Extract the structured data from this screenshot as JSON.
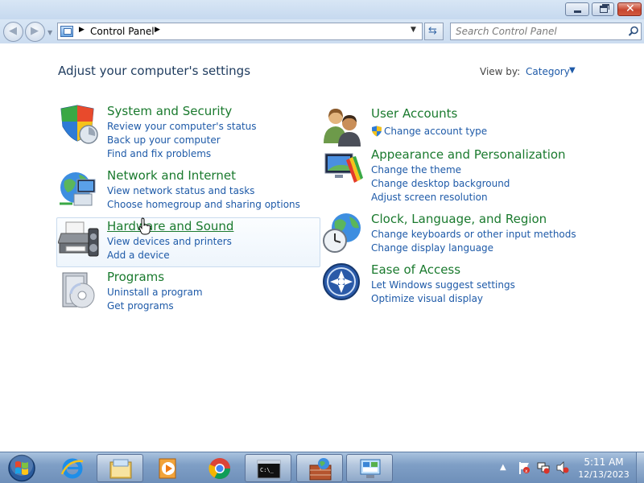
{
  "address": {
    "breadcrumb": "Control Panel",
    "search_placeholder": "Search Control Panel"
  },
  "page": {
    "heading": "Adjust your computer's settings",
    "view_by_label": "View by:",
    "view_by_value": "Category"
  },
  "categories": {
    "system_security": {
      "title": "System and Security",
      "links": [
        "Review your computer's status",
        "Back up your computer",
        "Find and fix problems"
      ]
    },
    "network_internet": {
      "title": "Network and Internet",
      "links": [
        "View network status and tasks",
        "Choose homegroup and sharing options"
      ]
    },
    "hardware_sound": {
      "title": "Hardware and Sound",
      "links": [
        "View devices and printers",
        "Add a device"
      ]
    },
    "programs": {
      "title": "Programs",
      "links": [
        "Uninstall a program",
        "Get programs"
      ]
    },
    "user_accounts": {
      "title": "User Accounts",
      "links": [
        "Change account type"
      ]
    },
    "appearance": {
      "title": "Appearance and Personalization",
      "links": [
        "Change the theme",
        "Change desktop background",
        "Adjust screen resolution"
      ]
    },
    "clock_region": {
      "title": "Clock, Language, and Region",
      "links": [
        "Change keyboards or other input methods",
        "Change display language"
      ]
    },
    "ease_access": {
      "title": "Ease of Access",
      "links": [
        "Let Windows suggest settings",
        "Optimize visual display"
      ]
    }
  },
  "taskbar": {
    "time": "5:11 AM",
    "date": "12/13/2023",
    "apps": [
      "internet-explorer-icon",
      "file-explorer-icon",
      "media-player-icon",
      "chrome-icon",
      "command-prompt-icon",
      "firewall-icon",
      "control-panel-icon"
    ]
  },
  "colors": {
    "category_title": "#1a7a2e",
    "link": "#1e5aa8",
    "heading": "#1e3b5e",
    "taskbar": "#7f9fc6"
  }
}
